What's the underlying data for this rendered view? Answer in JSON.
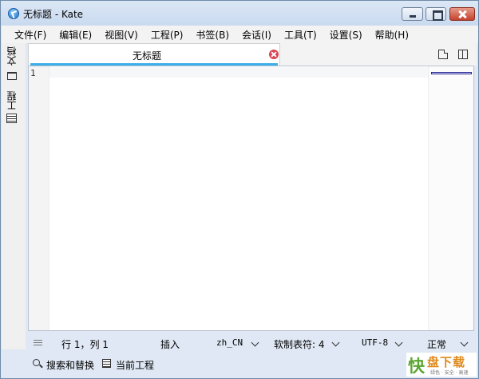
{
  "window": {
    "title": "无标题  - Kate"
  },
  "menubar": {
    "items": [
      "文件(F)",
      "编辑(E)",
      "视图(V)",
      "工程(P)",
      "书签(B)",
      "会话(I)",
      "工具(T)",
      "设置(S)",
      "帮助(H)"
    ]
  },
  "sidepanel": {
    "documents_label": "文档",
    "documents_icon": "folder-icon",
    "projects_label": "工程",
    "projects_icon": "list-icon"
  },
  "tabs": {
    "active_label": "无标题",
    "close_icon": "close-icon",
    "accent_color": "#3daee9"
  },
  "editor": {
    "line_numbers": [
      "1"
    ],
    "content": ""
  },
  "statusbar": {
    "cursor": "行 1，列 1",
    "mode": "插入",
    "dictionary": "zh_CN",
    "indent": "软制表符: 4",
    "encoding": "UTF-8",
    "eol": "正常"
  },
  "bottombar": {
    "search_replace": "搜索和替换",
    "current_project": "当前工程"
  },
  "watermark": {
    "glyph": "快",
    "title": "盘下载",
    "subtitle": "绿色 · 安全 · 高速"
  }
}
